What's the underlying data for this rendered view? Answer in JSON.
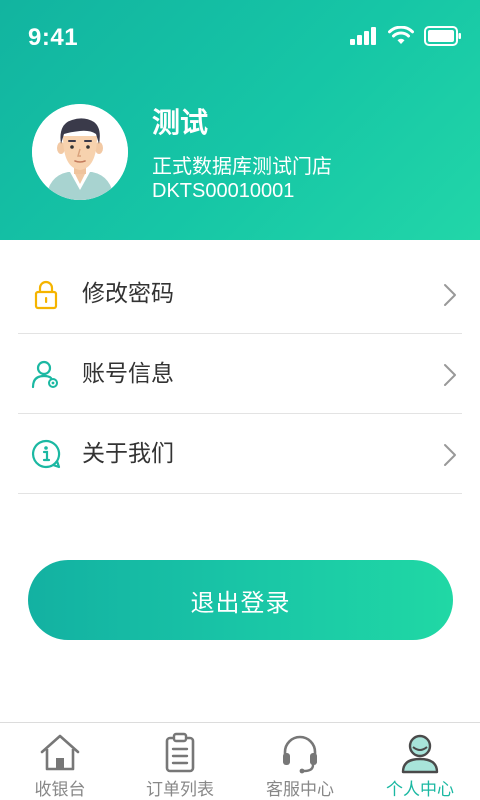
{
  "status_bar": {
    "time": "9:41"
  },
  "profile": {
    "name": "测试",
    "store": "正式数据库测试门店",
    "code": "DKTS00010001"
  },
  "menu": {
    "items": [
      {
        "label": "修改密码",
        "icon": "lock-icon"
      },
      {
        "label": "账号信息",
        "icon": "user-settings-icon"
      },
      {
        "label": "关于我们",
        "icon": "info-bubble-icon"
      }
    ]
  },
  "logout": {
    "label": "退出登录"
  },
  "tabbar": {
    "active_index": 3,
    "tabs": [
      {
        "label": "收银台",
        "icon": "home-icon"
      },
      {
        "label": "订单列表",
        "icon": "clipboard-icon"
      },
      {
        "label": "客服中心",
        "icon": "headset-icon"
      },
      {
        "label": "个人中心",
        "icon": "person-icon"
      }
    ]
  },
  "colors": {
    "accent": "#1bb8a2",
    "header_start": "#12b4a0",
    "header_end": "#22d6a8",
    "lock_icon": "#f5b400",
    "tab_inactive": "#888888"
  }
}
